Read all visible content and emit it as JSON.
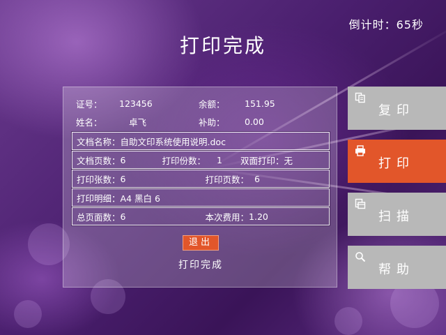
{
  "header": {
    "countdown": "倒计时：65秒",
    "title": "打印完成"
  },
  "account": {
    "id_label": "证号：",
    "id_value": "123456",
    "balance_label": "余额：",
    "balance_value": "151.95",
    "name_label": "姓名：",
    "name_value": "卓飞",
    "subsidy_label": "补助：",
    "subsidy_value": "0.00"
  },
  "job": {
    "doc_name_label": "文档名称：",
    "doc_name_value": "自助文印系统使用说明.doc",
    "doc_pages_label": "文档页数：",
    "doc_pages_value": "6",
    "copies_label": "打印份数：",
    "copies_value": "1",
    "duplex_label": "双面打印：",
    "duplex_value": "无",
    "sheets_label": "打印张数：",
    "sheets_value": "6",
    "print_pages_label": "打印页数：",
    "print_pages_value": "6",
    "detail_label": "打印明细：",
    "detail_value": "A4 黑白 6",
    "total_pages_label": "总页面数：",
    "total_pages_value": "6",
    "fee_label": "本次费用：",
    "fee_value": "1.20"
  },
  "actions": {
    "exit_label": "退出",
    "status_text": "打印完成"
  },
  "sidebar": {
    "items": [
      {
        "label": "复印",
        "icon": "copy-icon",
        "active": false
      },
      {
        "label": "打印",
        "icon": "printer-icon",
        "active": true
      },
      {
        "label": "扫描",
        "icon": "scan-icon",
        "active": false
      },
      {
        "label": "帮助",
        "icon": "help-icon",
        "active": false
      }
    ]
  },
  "colors": {
    "accent": "#e2562a",
    "sidebar_inactive": "#b8b8b8",
    "background": "#4a1f6e"
  }
}
